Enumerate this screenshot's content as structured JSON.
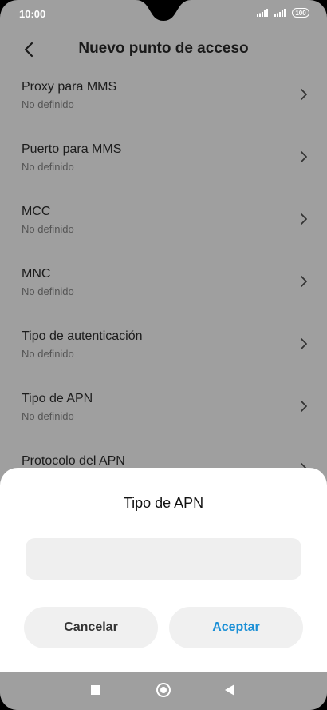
{
  "status_bar": {
    "time": "10:00",
    "battery": "100"
  },
  "header": {
    "title": "Nuevo punto de acceso"
  },
  "settings": {
    "items": [
      {
        "title": "Proxy para MMS",
        "value": "No definido"
      },
      {
        "title": "Puerto para MMS",
        "value": "No definido"
      },
      {
        "title": "MCC",
        "value": "No definido"
      },
      {
        "title": "MNC",
        "value": "No definido"
      },
      {
        "title": "Tipo de autenticación",
        "value": "No definido"
      },
      {
        "title": "Tipo de APN",
        "value": "No definido"
      },
      {
        "title": "Protocolo del APN",
        "value": ""
      }
    ]
  },
  "dialog": {
    "title": "Tipo de APN",
    "input_value": "",
    "cancel_label": "Cancelar",
    "accept_label": "Aceptar"
  },
  "colors": {
    "background_dim": "#9f9f9f",
    "dialog_bg": "#ffffff",
    "accent": "#1a8fd6"
  },
  "icons": {
    "back": "back-arrow-icon",
    "chevron": "chevron-right-icon",
    "recents": "square-icon",
    "home": "circle-icon",
    "nav_back": "triangle-left-icon"
  }
}
